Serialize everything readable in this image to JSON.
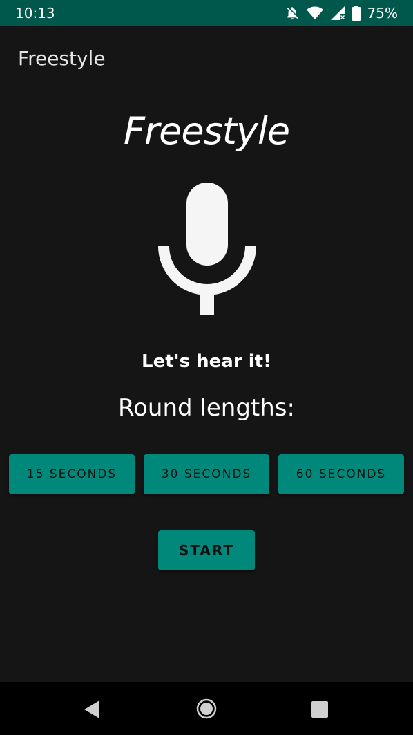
{
  "status_bar": {
    "time": "10:13",
    "battery_percent": "75%",
    "icons": [
      "notifications-off-icon",
      "wifi-icon",
      "signal-icon",
      "battery-icon"
    ]
  },
  "app_bar": {
    "title": "Freestyle"
  },
  "main": {
    "hero_title": "Freestyle",
    "icon": "microphone-icon",
    "tagline": "Let's hear it!",
    "round_lengths_label": "Round lengths:",
    "round_buttons": [
      {
        "label": "15 SECONDS"
      },
      {
        "label": "30 SECONDS"
      },
      {
        "label": "60 SECONDS"
      }
    ],
    "start_label": "START"
  },
  "nav_bar": {
    "icons": [
      "back-icon",
      "home-icon",
      "recents-icon"
    ]
  },
  "colors": {
    "status_bar": "#00574b",
    "background": "#151515",
    "accent": "#00897b",
    "text": "#ffffff"
  }
}
